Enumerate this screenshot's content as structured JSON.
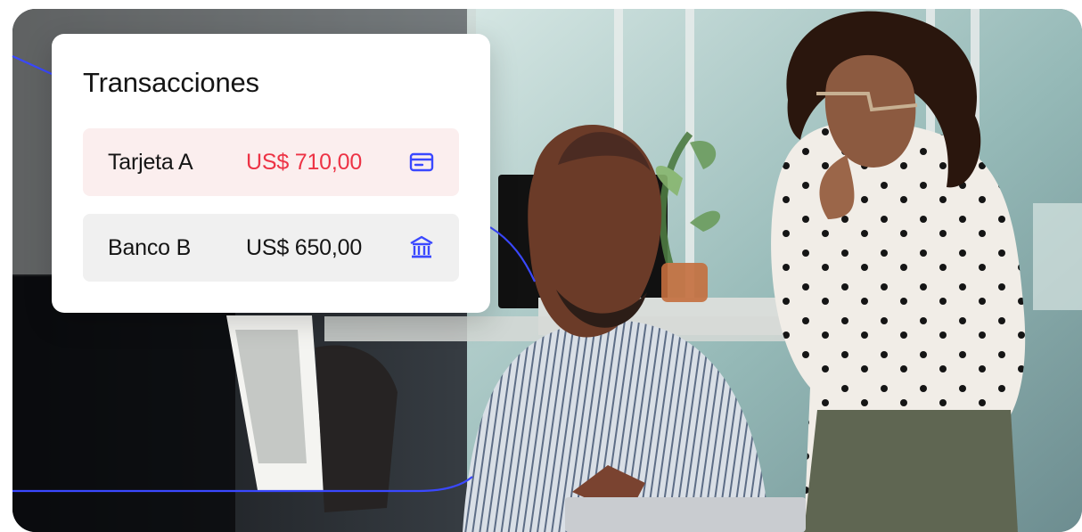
{
  "transactions_panel": {
    "title": "Transacciones",
    "rows": [
      {
        "name": "Tarjeta A",
        "amount": "US$ 710,00",
        "icon": "credit-card-icon",
        "amount_color": "#ed3345",
        "background": "#fbeeee"
      },
      {
        "name": "Banco B",
        "amount": "US$ 650,00",
        "icon": "bank-icon",
        "amount_color": "#151515",
        "background": "#f0f0f0"
      }
    ]
  },
  "decorative": {
    "connector_color": "#3a48ff",
    "image_subject": "office-meeting-photo"
  }
}
